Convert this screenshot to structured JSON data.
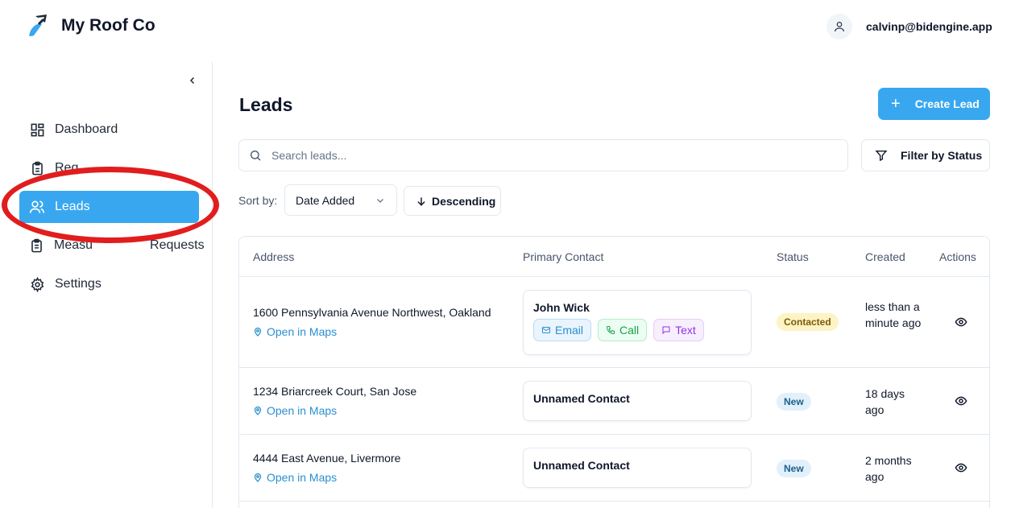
{
  "app": {
    "brand": "My Roof Co",
    "user_email": "calvinp@bidengine.app"
  },
  "sidebar": {
    "items": [
      {
        "label": "Dashboard",
        "icon": "dashboard-grid-icon"
      },
      {
        "label": "Req",
        "icon": "clipboard-icon"
      },
      {
        "label": "Leads",
        "icon": "users-icon",
        "active": true
      },
      {
        "label": "Measu",
        "label_tail": "Requests",
        "icon": "clipboard-list-icon"
      },
      {
        "label": "Settings",
        "icon": "gear-icon"
      }
    ]
  },
  "page": {
    "title": "Leads",
    "create_label": "Create Lead",
    "search_placeholder": "Search leads...",
    "filter_label": "Filter by Status",
    "sort_label": "Sort by:",
    "sort_value": "Date Added",
    "sort_direction": "Descending"
  },
  "table": {
    "headers": {
      "address": "Address",
      "contact": "Primary Contact",
      "status": "Status",
      "created": "Created",
      "actions": "Actions"
    },
    "maps_label": "Open in Maps",
    "rows": [
      {
        "address": "1600 Pennsylvania Avenue Northwest, Oakland",
        "contact": "John Wick",
        "chips": {
          "email": "Email",
          "call": "Call",
          "text": "Text"
        },
        "status": "Contacted",
        "created": "less than a minute ago"
      },
      {
        "address": "1234 Briarcreek Court, San Jose",
        "contact": "Unnamed Contact",
        "status": "New",
        "created": "18 days ago"
      },
      {
        "address": "4444 East Avenue, Livermore",
        "contact": "Unnamed Contact",
        "status": "New",
        "created": "2 months ago"
      }
    ]
  },
  "colors": {
    "accent": "#38a7ef",
    "annotation": "#e11d1d"
  }
}
